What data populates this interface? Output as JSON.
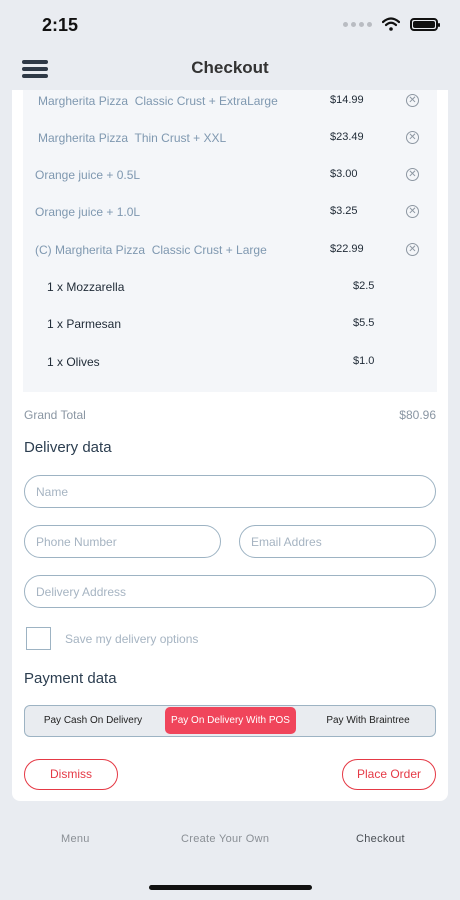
{
  "status_bar": {
    "time": "2:15",
    "icons": [
      "signal-dots-icon",
      "wifi-icon",
      "battery-icon"
    ]
  },
  "header": {
    "title": "Checkout",
    "menu_icon": "hamburger-menu-icon"
  },
  "order": {
    "items": [
      {
        "name": "Margherita Pizza  Classic Crust + ExtraLarge",
        "price": "$14.99"
      },
      {
        "name": "Margherita Pizza  Thin Crust + XXL",
        "price": "$23.49"
      },
      {
        "name": "Orange juice + 0.5L",
        "price": "$3.00"
      },
      {
        "name": "Orange juice + 1.0L",
        "price": "$3.25"
      },
      {
        "name": "(C) Margherita Pizza  Classic Crust + Large",
        "price": "$22.99"
      }
    ],
    "toppings": [
      {
        "name": "1 x Mozzarella",
        "price": "$2.5"
      },
      {
        "name": "1 x Parmesan",
        "price": "$5.5"
      },
      {
        "name": "1 x Olives",
        "price": "$1.0"
      }
    ],
    "remove_icon": "remove-circle-icon"
  },
  "grand_total": {
    "label": "Grand Total",
    "value": "$80.96"
  },
  "delivery": {
    "title": "Delivery data",
    "name_placeholder": "Name",
    "phone_placeholder": "Phone Number",
    "email_placeholder": "Email Addres",
    "address_placeholder": "Delivery Address",
    "save_label": "Save my delivery options"
  },
  "payment": {
    "title": "Payment data",
    "options": [
      "Pay Cash On Delivery",
      "Pay On Delivery With POS",
      "Pay With Braintree"
    ],
    "selected": "Pay On Delivery With POS"
  },
  "actions": {
    "dismiss": "Dismiss",
    "place_order": "Place Order"
  },
  "tabs": [
    "Menu",
    "Create Your Own",
    "Checkout"
  ],
  "active_tab": "Checkout",
  "colors": {
    "accent": "#f0455b",
    "button_red": "#e53945",
    "border": "#9db3c3",
    "muted_text": "#7f98b0"
  }
}
